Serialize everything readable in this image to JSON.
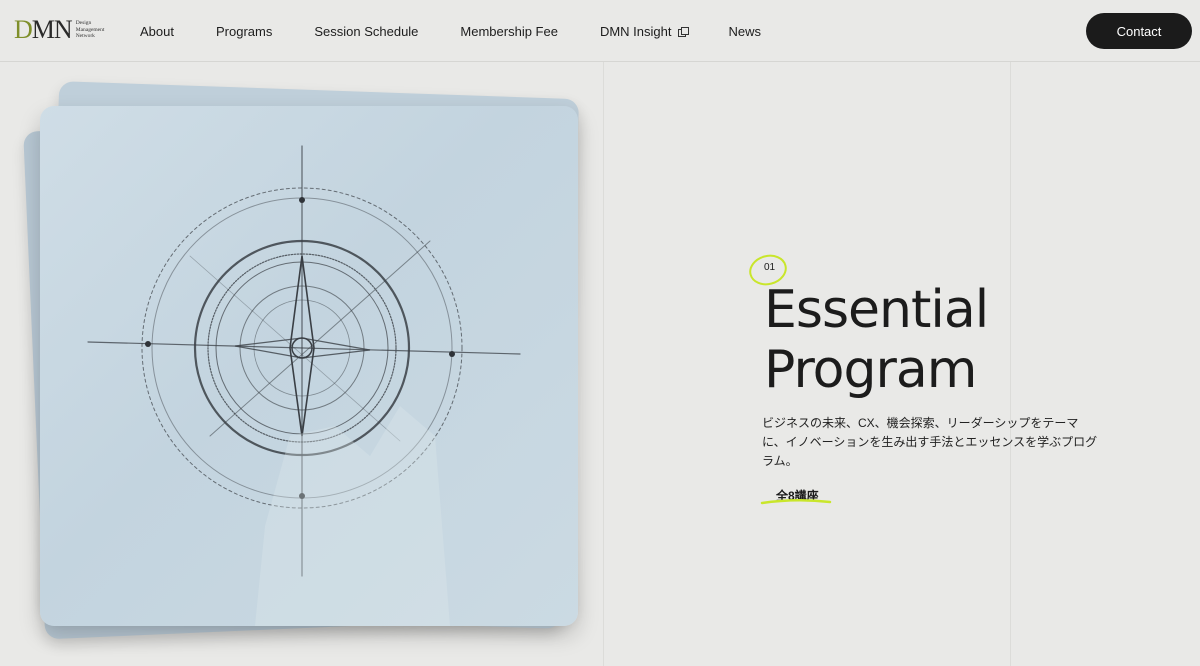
{
  "header": {
    "logo": {
      "mark": "DMN",
      "sub_lines": [
        "Design",
        "Management",
        "Network"
      ]
    },
    "nav": [
      {
        "label": "About",
        "external": false
      },
      {
        "label": "Programs",
        "external": false
      },
      {
        "label": "Session Schedule",
        "external": false
      },
      {
        "label": "Membership Fee",
        "external": false
      },
      {
        "label": "DMN Insight",
        "external": true
      },
      {
        "label": "News",
        "external": false
      }
    ],
    "contact_label": "Contact"
  },
  "program": {
    "number": "01",
    "title_line1": "Essential",
    "title_line2": "Program",
    "description": "ビジネスの未来、CX、機会探索、リーダーシップをテーマに、イノベーションを生み出す手法とエッセンスを学ぶプログラム。",
    "count_label": "全8講座"
  },
  "colors": {
    "accent": "#c9e62b",
    "paper": "#c7d7e1",
    "button": "#1b1b1b",
    "background": "#e9e9e7"
  },
  "icons": {
    "external_link": "external-link-icon",
    "illustration": "compass-sketch"
  }
}
